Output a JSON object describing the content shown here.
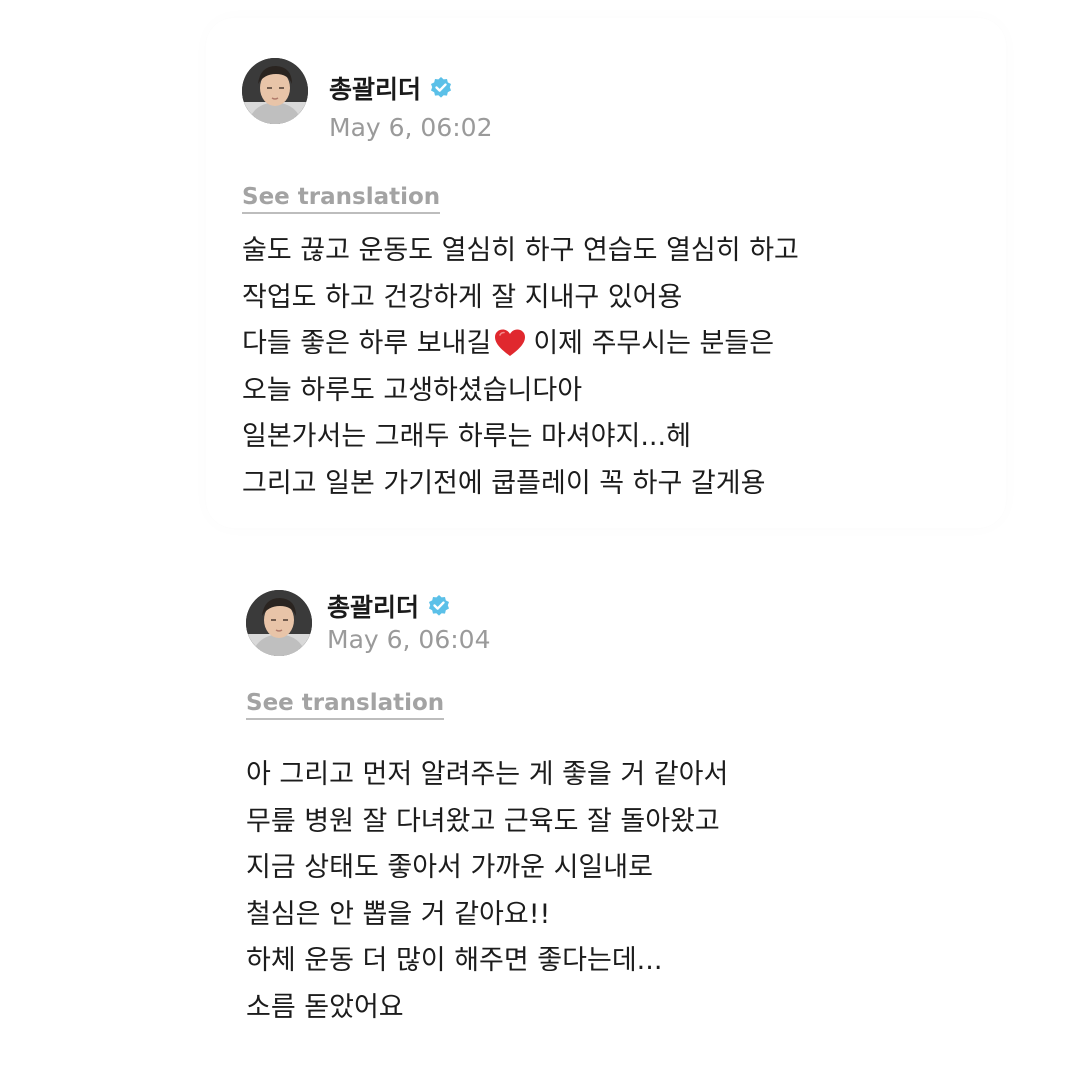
{
  "posts": [
    {
      "username": "총괄리더",
      "timestamp": "May 6, 06:02",
      "translate_label": "See translation",
      "lines": [
        "술도 끊고 운동도 열심히 하구 연습도 열심히 하고",
        "작업도 하고 건강하게  잘 지내구 있어용",
        "다들 좋은 하루 보내길",
        "이제 주무시는 분들은",
        "오늘 하루도 고생하셨습니다아",
        "일본가서는 그래두 하루는 마셔야지...헤",
        "그리고 일본 가기전에 쿱플레이 꼭 하구 갈게용"
      ]
    },
    {
      "username": "총괄리더",
      "timestamp": "May 6, 06:04",
      "translate_label": "See translation",
      "lines": [
        "아 그리고 먼저 알려주는 게 좋을 거 같아서",
        "무릎 병원 잘 다녀왔고 근육도 잘 돌아왔고",
        "지금 상태도 좋아서 가까운 시일내로",
        "철심은 안 뽑을 거 같아요!!",
        "하체 운동 더 많이 해주면 좋다는데...",
        "소름 돋았어요"
      ]
    }
  ],
  "icons": {
    "verified": "verified-badge-icon",
    "heart": "red-heart-icon"
  },
  "colors": {
    "verified": "#5bc0e8",
    "heart": "#e0282e",
    "timestamp": "#9a9a9a",
    "translate": "#a3a3a3"
  }
}
